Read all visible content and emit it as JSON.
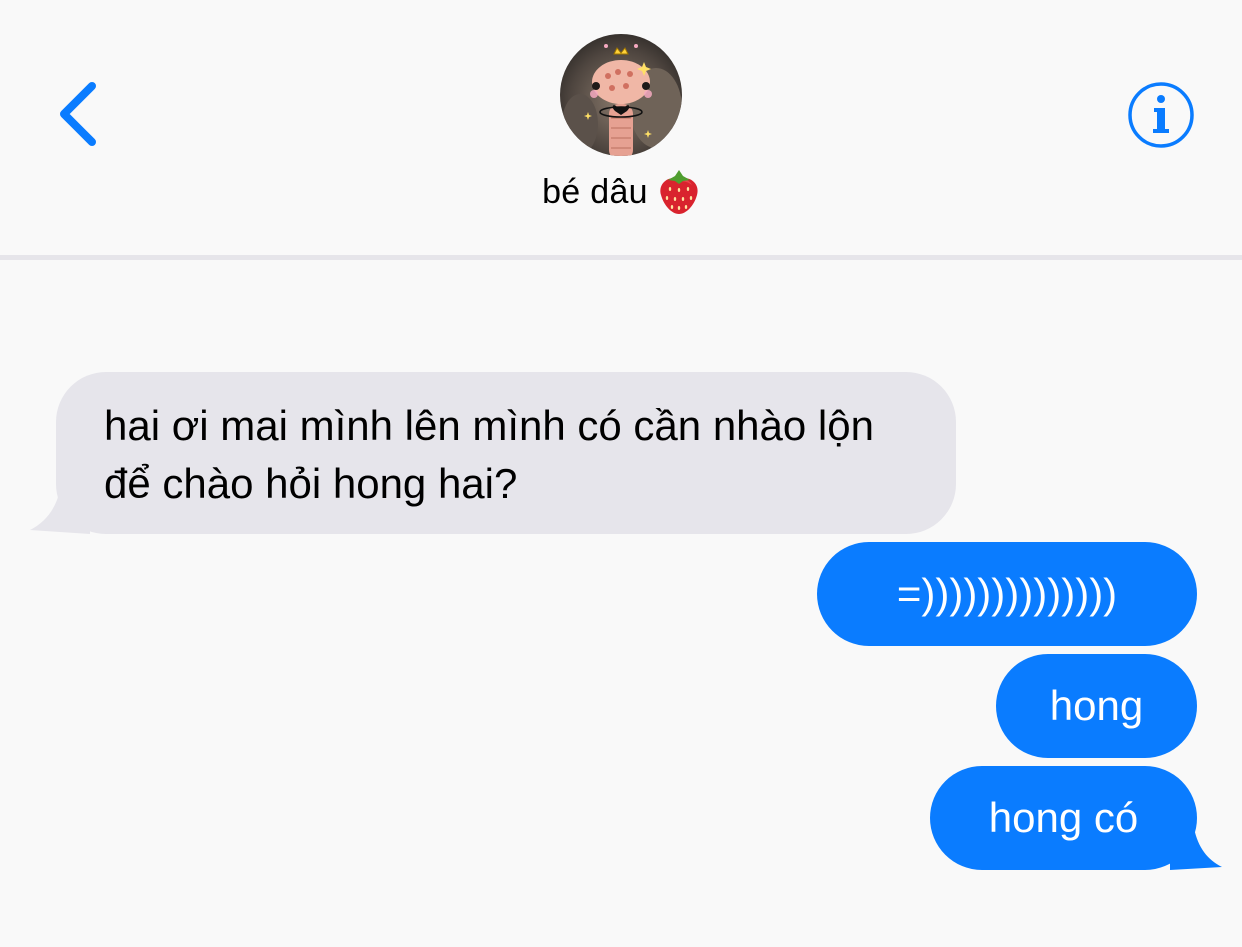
{
  "header": {
    "contact_name": "bé dâu",
    "contact_emoji_icon": "strawberry-icon",
    "back_icon": "chevron-left-icon",
    "info_icon": "info-icon"
  },
  "colors": {
    "accent": "#0a7cff",
    "incoming_bubble": "#e6e5eb",
    "background": "#f9f9f9"
  },
  "messages": {
    "incoming": [
      {
        "text": "hai ơi mai mình lên mình có cần nhào lộn để chào hỏi hong hai?"
      }
    ],
    "outgoing": [
      {
        "text": "=))))))))))))))"
      },
      {
        "text": "hong"
      },
      {
        "text": "hong có"
      }
    ]
  }
}
